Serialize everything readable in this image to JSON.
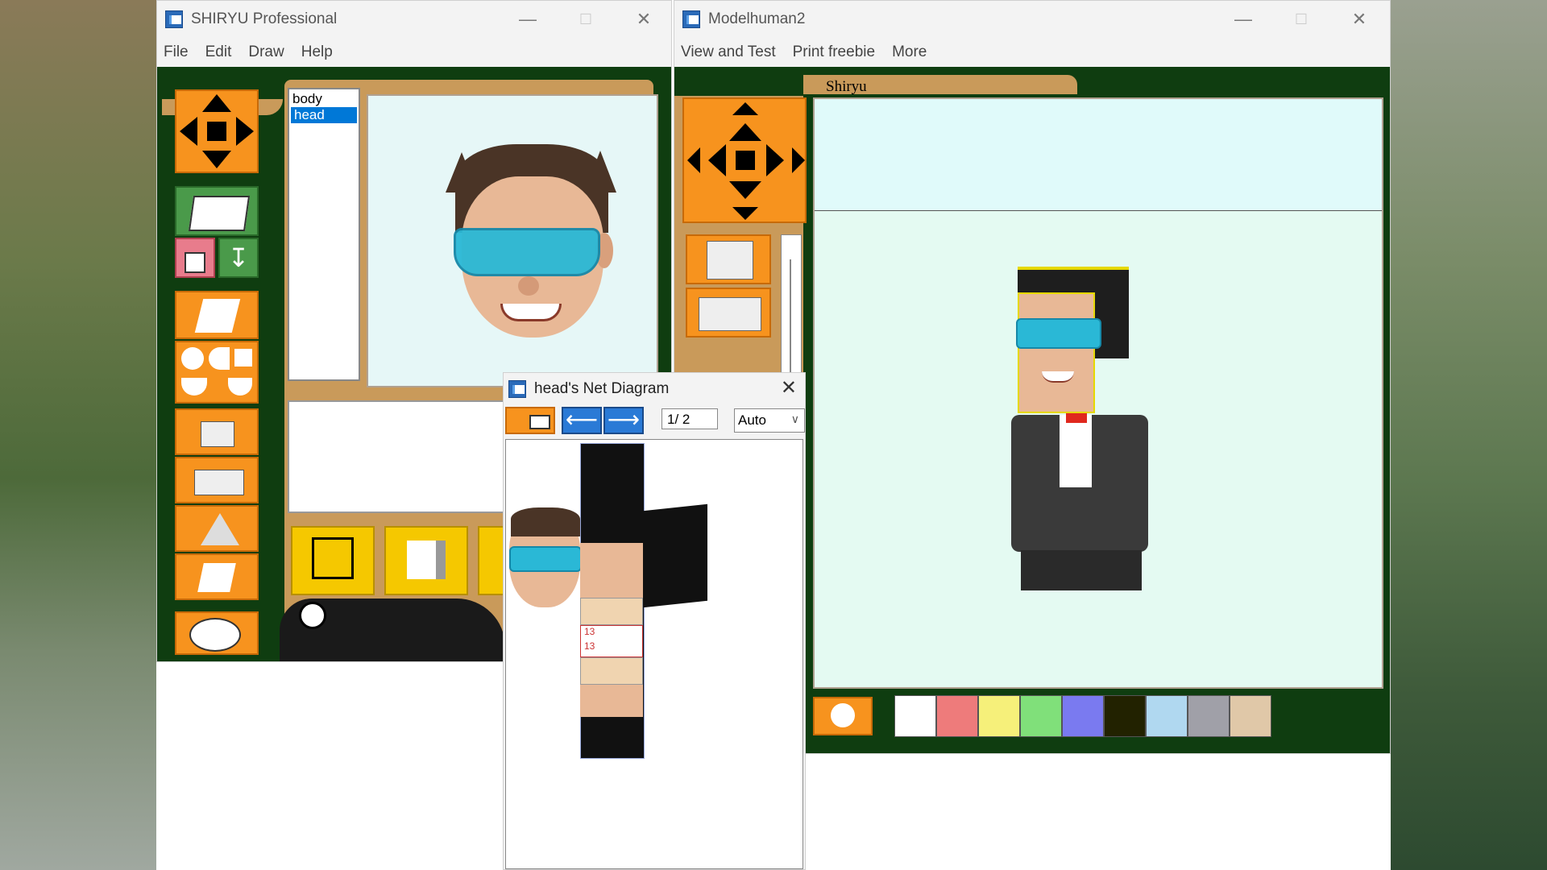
{
  "left_window": {
    "title": "SHIRYU Professional",
    "menu": [
      "File",
      "Edit",
      "Draw",
      "Help"
    ],
    "parts_list": [
      "body",
      "head"
    ],
    "selected_part": "head"
  },
  "right_window": {
    "title": "Modelhuman2",
    "menu": [
      "View and Test",
      "Print freebie",
      "More"
    ],
    "tab_label": "Shiryu",
    "palette": [
      {
        "name": "white",
        "color": "#ffffff"
      },
      {
        "name": "red",
        "color": "#ee7b7b"
      },
      {
        "name": "yellow",
        "color": "#f6f07a"
      },
      {
        "name": "green",
        "color": "#80e07a"
      },
      {
        "name": "blue",
        "color": "#7a7af0"
      },
      {
        "name": "black-yellow-texture",
        "color": "#222200"
      },
      {
        "name": "iridescent-texture",
        "color": "#b0d8f0"
      },
      {
        "name": "pebble-texture",
        "color": "#a0a0a8"
      },
      {
        "name": "wood-texture",
        "color": "#e0c8a8"
      }
    ]
  },
  "net_dialog": {
    "title": "head's Net Diagram",
    "page": "1/ 2",
    "zoom": "Auto",
    "labels": [
      "13",
      "13"
    ]
  },
  "icons": {
    "close": "close-icon",
    "minimize": "minimize-icon",
    "maximize": "maximize-icon"
  }
}
